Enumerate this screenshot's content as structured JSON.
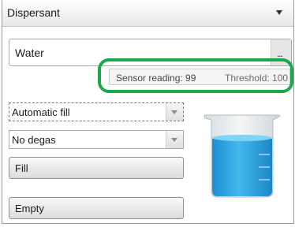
{
  "panel": {
    "title": "Dispersant",
    "collapse_icon": "chevron-down-icon"
  },
  "dispersant": {
    "value": "Water",
    "browse_label": "..."
  },
  "sensor": {
    "reading_text": "Sensor reading: 99",
    "threshold_text": "Threshold: 100",
    "highlight_color": "#19a84a"
  },
  "fill_mode": {
    "selected": "Automatic fill"
  },
  "degas_mode": {
    "selected": "No degas"
  },
  "buttons": {
    "fill_label": "Fill",
    "empty_label": "Empty"
  },
  "beaker": {
    "icon": "beaker-icon",
    "liquid_color": "#29a8e8"
  }
}
